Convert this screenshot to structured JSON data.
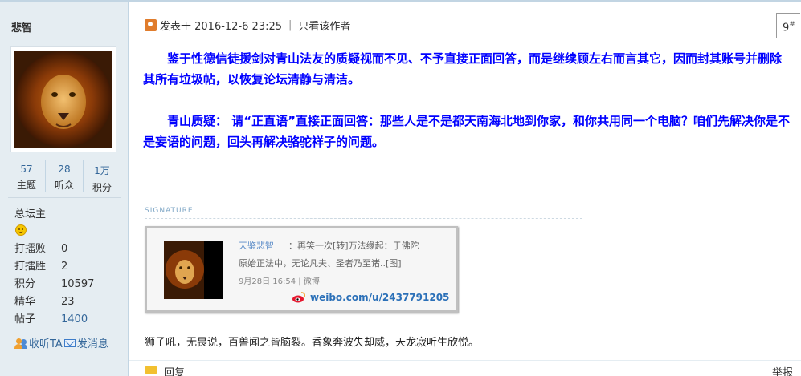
{
  "user": {
    "name": "悲智",
    "stats": [
      {
        "value": "57",
        "label": "主题"
      },
      {
        "value": "28",
        "label": "听众"
      },
      {
        "value": "1万",
        "label": "积分"
      }
    ],
    "group": "总坛主",
    "info": [
      {
        "key": "打擂败",
        "value": "0"
      },
      {
        "key": "打擂胜",
        "value": "2"
      },
      {
        "key": "积分",
        "value": "10597"
      },
      {
        "key": "精华",
        "value": "23"
      },
      {
        "key": "帖子",
        "value": "1400"
      }
    ],
    "follow_label": "收听TA",
    "message_label": "发消息"
  },
  "post": {
    "posted_at": "发表于 2016-12-6 23:25",
    "only_author": "只看该作者",
    "floor": "9",
    "floor_sup": "#",
    "paragraph1": "鉴于性德信徒援剑对青山法友的质疑视而不见、不予直接正面回答，而是继续顾左右而言其它，因而封其账号并删除其所有垃圾帖，以恢复论坛清静与清洁。",
    "paragraph2": "青山质疑：  请“正直语”直接正面回答：那些人是不是都天南海北地到你家，和你共用同一个电脑？咱们先解决你是不是妄语的问题，回头再解决骆驼祥子的问题。"
  },
  "signature": {
    "label": "SIGNATURE",
    "weibo_name": "天鉴悲智",
    "weibo_text1": "：再笑一次[转]万法缘起：于佛陀",
    "weibo_text2": "原始正法中，无论凡夫、圣者乃至诸..[图]",
    "weibo_time": "9月28日 16:54 | 微博",
    "weibo_url": "weibo.com/u/2437791205",
    "motto": "狮子吼，无畏说，百兽闻之皆脑裂。香象奔波失却威，天龙寂听生欣悦。"
  },
  "footer": {
    "reply_label": "回复",
    "report_label": "举报"
  },
  "colors": {
    "sidebar_bg": "#e5edf2",
    "post_text": "#0000ff",
    "link": "#336699"
  }
}
